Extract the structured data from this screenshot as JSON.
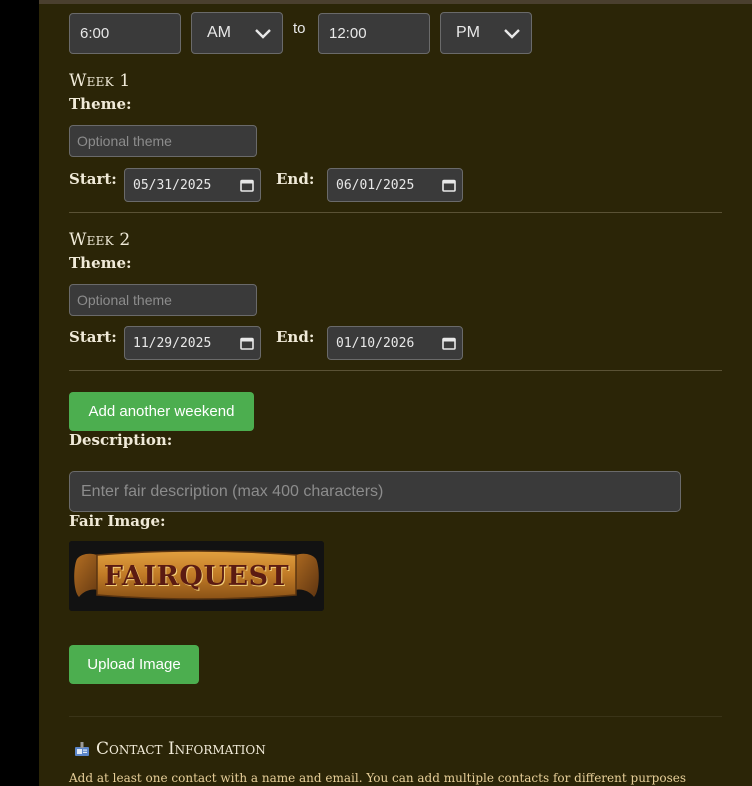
{
  "time": {
    "start_time": "6:00",
    "start_period": "AM",
    "separator": "to",
    "end_time": "12:00",
    "end_period": "PM"
  },
  "weeks": [
    {
      "title": "Week 1",
      "theme_label": "Theme:",
      "theme_placeholder": "Optional theme",
      "start_label": "Start:",
      "start_date": "05/31/2025",
      "end_label": "End:",
      "end_date": "06/01/2025"
    },
    {
      "title": "Week 2",
      "theme_label": "Theme:",
      "theme_placeholder": "Optional theme",
      "start_label": "Start:",
      "start_date": "11/29/2025",
      "end_label": "End:",
      "end_date": "01/10/2026"
    }
  ],
  "add_weekend_button": "Add another weekend",
  "description": {
    "label": "Description:",
    "placeholder": "Enter fair description (max 400 characters)"
  },
  "fair_image": {
    "label": "Fair Image:",
    "logo_text": "FAIRQUEST",
    "upload_button": "Upload Image"
  },
  "contact": {
    "title": "Contact Information",
    "description": "Add at least one contact with a name and email. You can add multiple contacts for different purposes"
  },
  "colors": {
    "panel_bg": "#2b2507",
    "button_green": "#4cae4f",
    "input_bg": "#3a3a3a",
    "label_text": "#f0ead8",
    "contact_text": "#e7cf99"
  },
  "icons": {
    "select_arrow": "chevron-down-icon",
    "date_picker": "calendar-icon",
    "contact_section": "contact-card-icon"
  }
}
